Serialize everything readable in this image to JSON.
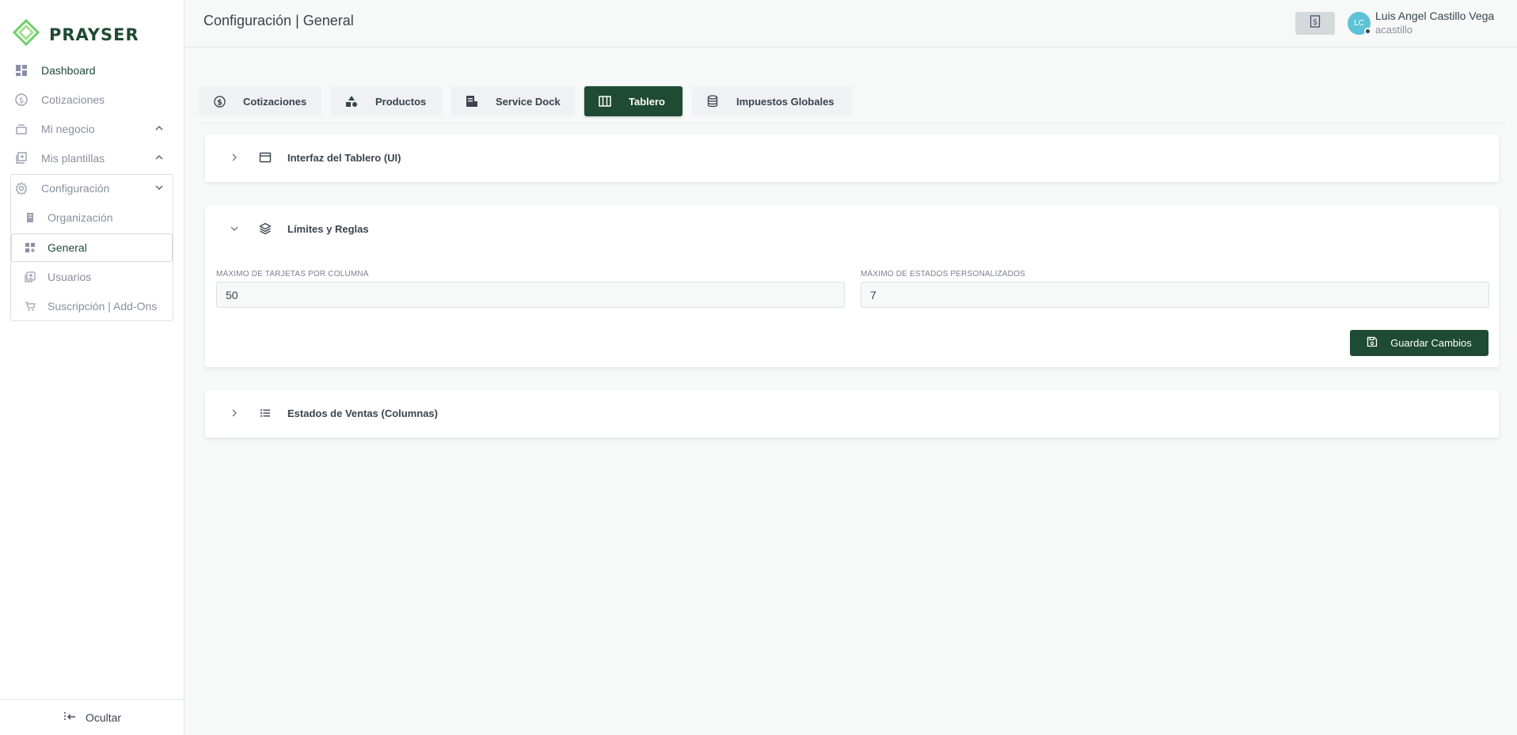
{
  "brand": {
    "name": "PRAYSER",
    "accent": "#1f4a33",
    "logo_colors": [
      "#6fcf6a",
      "#a6e08f"
    ]
  },
  "sidebar": {
    "items": [
      {
        "label": "Dashboard",
        "icon": "dashboard-icon",
        "active": true
      },
      {
        "label": "Cotizaciones",
        "icon": "dollar-circle-icon"
      },
      {
        "label": "Mi negocio",
        "icon": "stack-icon",
        "expandable": true
      },
      {
        "label": "Mis plantillas",
        "icon": "template-icon",
        "expandable": true
      },
      {
        "label": "Configuración",
        "icon": "gear-icon",
        "expanded": true
      }
    ],
    "sub_items": [
      {
        "label": "Organización",
        "icon": "building-icon"
      },
      {
        "label": "General",
        "icon": "grid-plus-icon",
        "selected": true
      },
      {
        "label": "Usuarios",
        "icon": "users-icon"
      },
      {
        "label": "Suscripción | Add-Ons",
        "icon": "cart-icon"
      }
    ],
    "footer": {
      "label": "Ocultar",
      "icon": "collapse-left-icon"
    }
  },
  "header": {
    "title": "Configuración | General",
    "user": {
      "initials": "LC",
      "name": "Luis Angel Castillo Vega",
      "handle": "acastillo"
    }
  },
  "tabs": [
    {
      "label": "Cotizaciones",
      "icon": "dollar-circle-icon"
    },
    {
      "label": "Productos",
      "icon": "shapes-icon"
    },
    {
      "label": "Service Dock",
      "icon": "receipt-icon"
    },
    {
      "label": "Tablero",
      "icon": "board-icon",
      "active": true
    },
    {
      "label": "Impuestos Globales",
      "icon": "database-icon"
    }
  ],
  "panels": {
    "ui": {
      "title": "Interfaz del Tablero (UI)",
      "icon": "window-icon"
    },
    "limits": {
      "title": "Límites y Reglas",
      "icon": "layers-icon",
      "fields": [
        {
          "label": "Máximo de tarjetas por columna",
          "value": "50"
        },
        {
          "label": "Máximo de estados personalizados",
          "value": "7"
        }
      ],
      "save_label": "Guardar Cambios"
    },
    "states": {
      "title": "Estados de Ventas (Columnas)",
      "icon": "list-icon"
    }
  }
}
